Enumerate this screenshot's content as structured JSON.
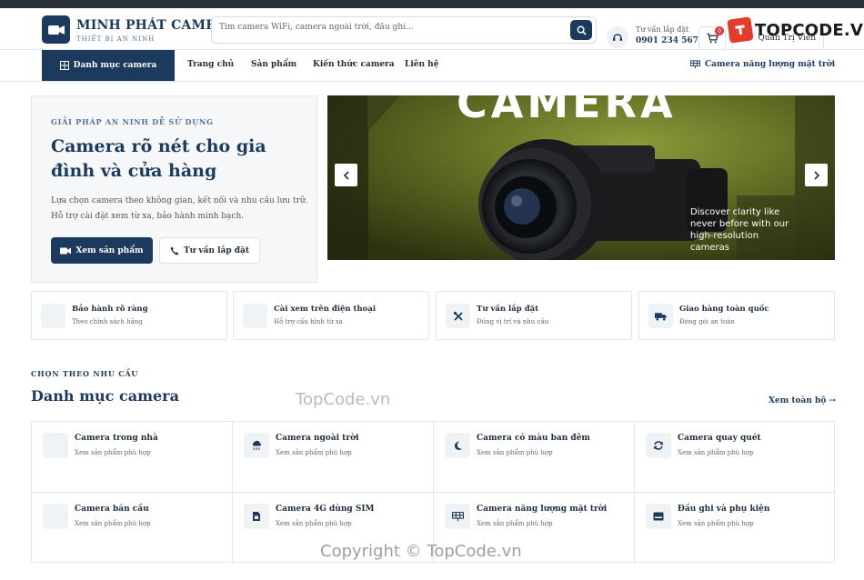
{
  "brand": {
    "name": "MINH PHÁT CAMERA",
    "tagline": "THIẾT BỊ AN NINH",
    "color": "#1c3a5e"
  },
  "search": {
    "placeholder": "Tìm camera WiFi, camera ngoài trời, đầu ghi..."
  },
  "support": {
    "label": "Tư vấn lắp đặt",
    "phone": "0901 234 567"
  },
  "cart": {
    "count": "0"
  },
  "admin": {
    "label": "Quản Trị Viên"
  },
  "watermark": {
    "logo_text": "TOPCODE.VN",
    "center_text": "TopCode.vn",
    "bottom_text": "Copyright © TopCode.vn"
  },
  "nav": {
    "category_button": "Danh mục camera",
    "links": [
      "Trang chủ",
      "Sản phẩm",
      "Kiến thức camera",
      "Liên hệ"
    ],
    "solar_link": "Camera năng lượng mặt trời"
  },
  "hero": {
    "eyebrow": "GIẢI PHÁP AN NINH DỄ SỬ DỤNG",
    "title": "Camera rõ nét cho gia đình và cửa hàng",
    "description": "Lựa chọn camera theo không gian, kết nối và nhu cầu lưu trữ. Hỗ trợ cài đặt xem từ xa, bảo hành minh bạch.",
    "primary_button": "Xem sản phẩm",
    "secondary_button": "Tư vấn lắp đặt"
  },
  "slider": {
    "banner_text": "CAMERA",
    "caption": "Discover clarity like never before with our high-resolution cameras",
    "prev": "‹",
    "next": "›"
  },
  "features": [
    {
      "title": "Bảo hành rõ ràng",
      "subtitle": "Theo chính sách hãng",
      "icon": "shield-icon"
    },
    {
      "title": "Cài xem trên điện thoại",
      "subtitle": "Hỗ trợ cấu hình từ xa",
      "icon": "phone-icon"
    },
    {
      "title": "Tư vấn lắp đặt",
      "subtitle": "Đúng vị trí và nhu cầu",
      "icon": "tools-icon"
    },
    {
      "title": "Giao hàng toàn quốc",
      "subtitle": "Đóng gói an toàn",
      "icon": "truck-icon"
    }
  ],
  "categories_section": {
    "eyebrow": "CHỌN THEO NHU CẦU",
    "title": "Danh mục camera",
    "see_all": "Xem toàn bộ →",
    "items": [
      {
        "title": "Camera trong nhà",
        "subtitle": "Xem sản phẩm phù hợp",
        "icon": "home-icon"
      },
      {
        "title": "Camera ngoài trời",
        "subtitle": "Xem sản phẩm phù hợp",
        "icon": "cloud-rain-icon"
      },
      {
        "title": "Camera có màu ban đêm",
        "subtitle": "Xem sản phẩm phù hợp",
        "icon": "moon-icon"
      },
      {
        "title": "Camera quay quét",
        "subtitle": "Xem sản phẩm phù hợp",
        "icon": "rotate-icon"
      },
      {
        "title": "Camera bán cầu",
        "subtitle": "Xem sản phẩm phù hợp",
        "icon": "dome-icon"
      },
      {
        "title": "Camera 4G dùng SIM",
        "subtitle": "Xem sản phẩm phù hợp",
        "icon": "sim-card-icon"
      },
      {
        "title": "Camera năng lượng mặt trời",
        "subtitle": "Xem sản phẩm phù hợp",
        "icon": "solar-panel-icon"
      },
      {
        "title": "Đầu ghi và phụ kiện",
        "subtitle": "Xem sản phẩm phù hợp",
        "icon": "recorder-icon"
      }
    ]
  }
}
